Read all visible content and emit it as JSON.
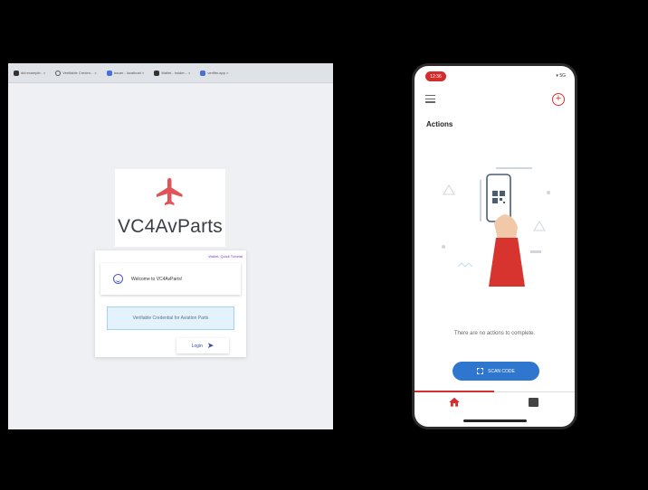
{
  "browser": {
    "tabs": [
      {
        "label": "did:example.. ×",
        "icon": "favicon-dark"
      },
      {
        "label": "Verifiable Creden... ×",
        "icon": "favicon-ring"
      },
      {
        "label": "issuer - localhost ×",
        "icon": "favicon-blue"
      },
      {
        "label": "Wallet - holder... ×",
        "icon": "favicon-dark"
      },
      {
        "label": "verifier.app ×",
        "icon": "favicon-blue"
      }
    ],
    "brand_name": "VC4AvParts",
    "brand_icon": "airplane-icon",
    "wallet_link": "Wallet: Quick Tutorial",
    "welcome_text": "Welcome to VC4AvParts!",
    "credential_text": "Verifiable Credential for Aviation Parts",
    "login_label": "Login",
    "colors": {
      "brand_red": "#e0555a",
      "accent": "#3b4aa8",
      "link": "#7b3fc4"
    }
  },
  "phone": {
    "time": "12:36",
    "status_right": "▾ 5G",
    "title": "Actions",
    "empty_message": "There are no actions to complete.",
    "scan_label": "SCAN CODE",
    "tabs": [
      {
        "icon": "home-icon",
        "active": true
      },
      {
        "icon": "inbox-icon",
        "active": false
      }
    ],
    "colors": {
      "accent_red": "#d32f2f",
      "button_blue": "#2f76cf"
    }
  }
}
